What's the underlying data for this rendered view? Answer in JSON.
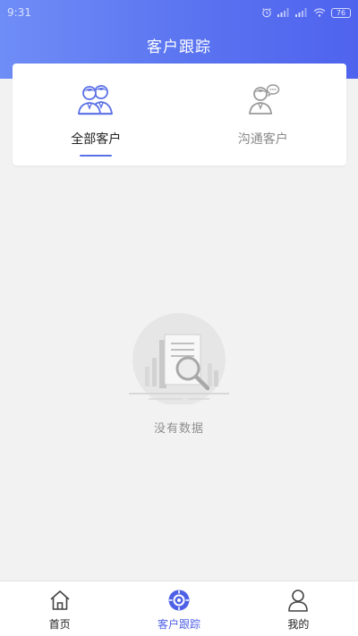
{
  "status_bar": {
    "time": "9:31",
    "battery": "76",
    "icons": [
      "alarm-icon",
      "signal-icon",
      "signal-icon",
      "wifi-icon",
      "battery-icon"
    ]
  },
  "header": {
    "title": "客户跟踪"
  },
  "tabs": [
    {
      "label": "全部客户",
      "icon": "customers-group-icon",
      "active": true
    },
    {
      "label": "沟通客户",
      "icon": "customer-chat-icon",
      "active": false
    }
  ],
  "empty_state": {
    "icon": "no-data-document-search-icon",
    "label": "没有数据"
  },
  "bottom_nav": [
    {
      "label": "首页",
      "icon": "home-icon",
      "active": false
    },
    {
      "label": "客户跟踪",
      "icon": "compass-icon",
      "active": true
    },
    {
      "label": "我的",
      "icon": "user-icon",
      "active": false
    }
  ],
  "colors": {
    "accent": "#4e60e6",
    "header_gradient_start": "#6f8df6",
    "header_gradient_end": "#4f63ee",
    "background": "#f2f2f2"
  }
}
